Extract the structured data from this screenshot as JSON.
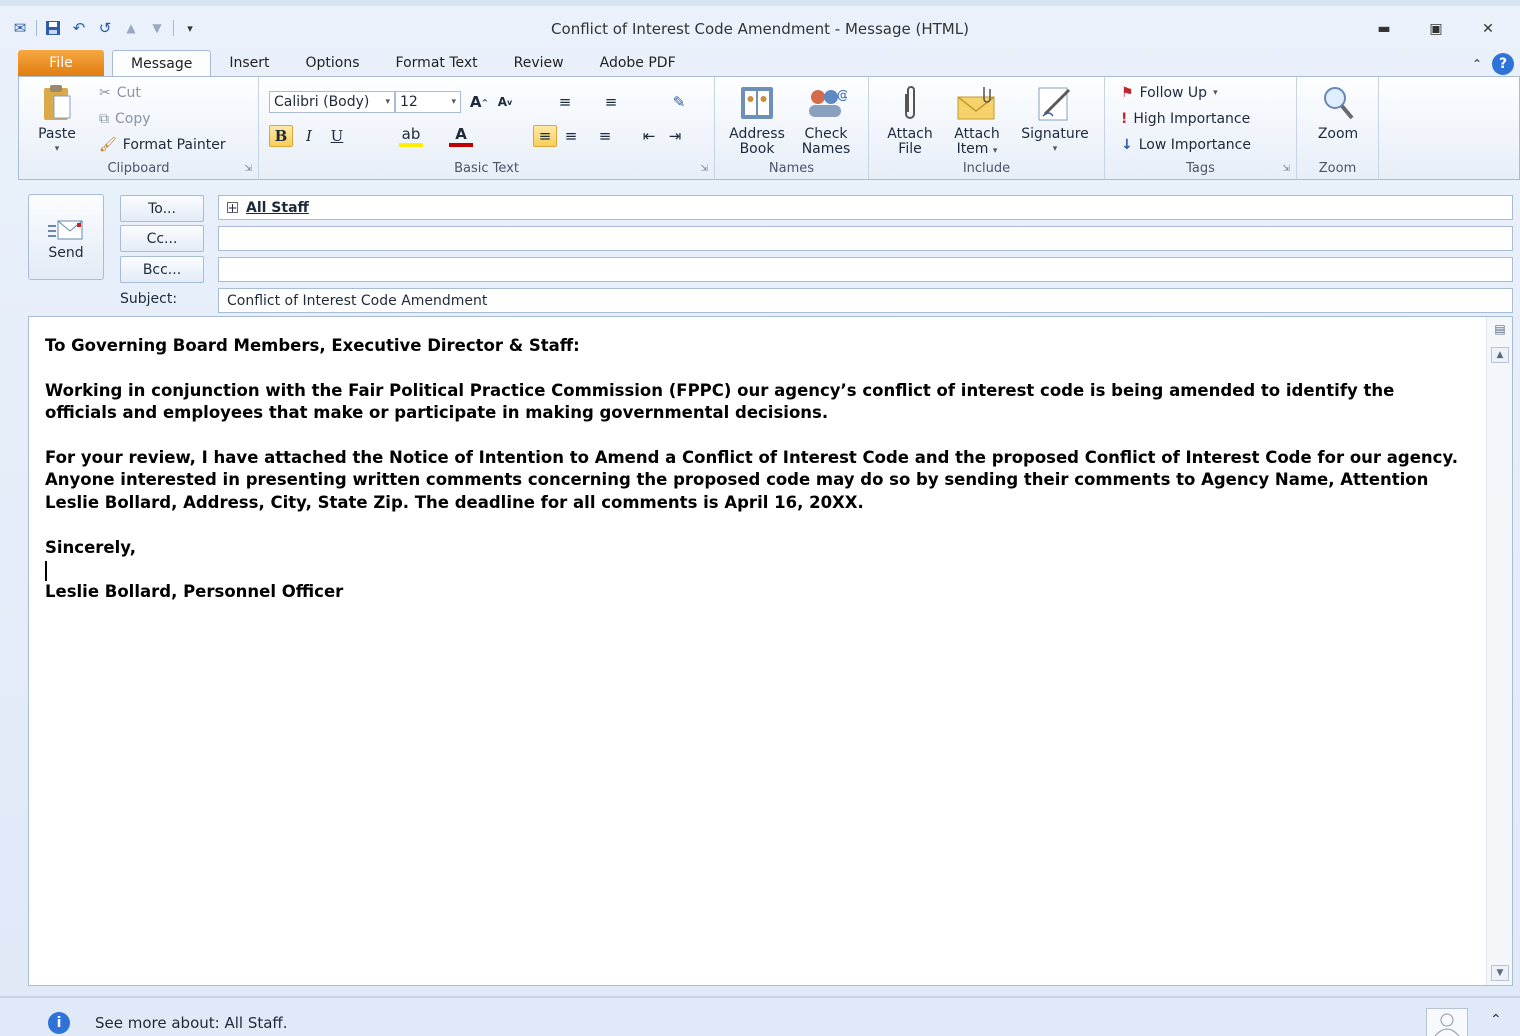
{
  "window": {
    "title": "Conflict of Interest Code Amendment - Message (HTML)"
  },
  "tabs": [
    {
      "label": "File"
    },
    {
      "label": "Message"
    },
    {
      "label": "Insert"
    },
    {
      "label": "Options"
    },
    {
      "label": "Format Text"
    },
    {
      "label": "Review"
    },
    {
      "label": "Adobe PDF"
    }
  ],
  "ribbon": {
    "clipboard": {
      "label": "Clipboard",
      "paste": "Paste",
      "cut": "Cut",
      "copy": "Copy",
      "format_painter": "Format Painter"
    },
    "basic_text": {
      "label": "Basic Text",
      "font": "Calibri (Body)",
      "size": "12"
    },
    "names": {
      "label": "Names",
      "address_book_line1": "Address",
      "address_book_line2": "Book",
      "check_names_line1": "Check",
      "check_names_line2": "Names"
    },
    "include": {
      "label": "Include",
      "attach_file_line1": "Attach",
      "attach_file_line2": "File",
      "attach_item_line1": "Attach",
      "attach_item_line2": "Item",
      "signature": "Signature"
    },
    "tags": {
      "label": "Tags",
      "follow_up": "Follow Up",
      "high_importance": "High Importance",
      "low_importance": "Low Importance"
    },
    "zoom": {
      "label": "Zoom",
      "zoom": "Zoom"
    }
  },
  "header": {
    "send": "Send",
    "to_button": "To...",
    "cc_button": "Cc...",
    "bcc_button": "Bcc...",
    "to_value": "All Staff",
    "cc_value": "",
    "bcc_value": "",
    "subject_label": "Subject:",
    "subject_value": "Conflict of Interest Code Amendment"
  },
  "body": {
    "salutation": "To Governing Board Members, Executive Director & Staff:",
    "paragraph1": "Working in conjunction with the Fair Political Practice Commission (FPPC) our agency’s conflict of interest code is being amended to identify the officials and employees that make or participate in making governmental decisions.",
    "paragraph2": "For your review, I have attached the Notice of Intention to Amend a Conflict of Interest Code and the proposed Conflict of Interest Code for our agency. Anyone interested in presenting written comments concerning the proposed code may do so by sending their comments to Agency Name, Attention Leslie Bollard, Address, City, State Zip.  The deadline for all comments is April 16, 20XX.",
    "closing": "Sincerely,",
    "signature": "Leslie Bollard, Personnel Officer"
  },
  "statusbar": {
    "text": "See more about: All Staff."
  }
}
